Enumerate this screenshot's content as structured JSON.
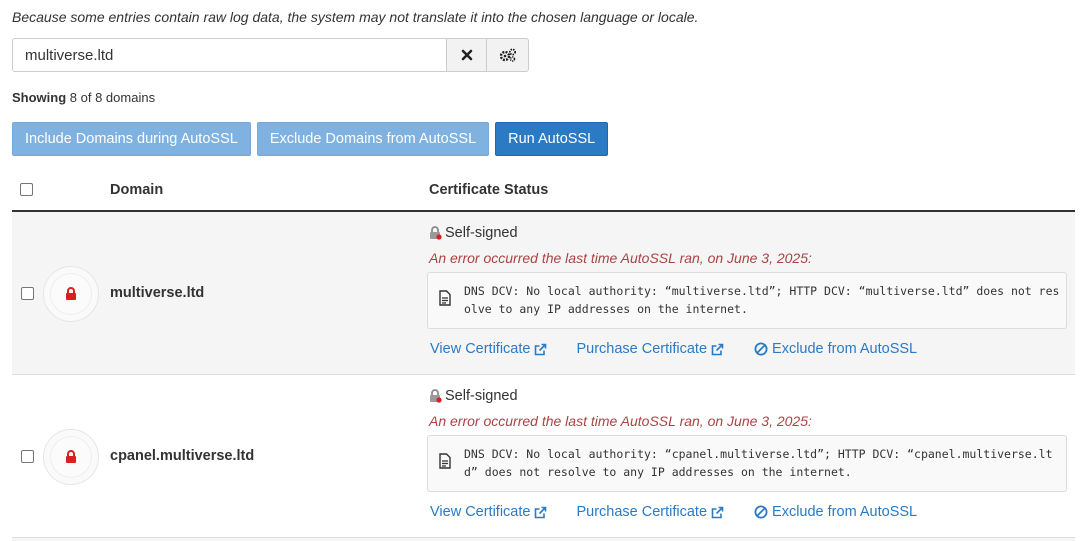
{
  "notice": "Because some entries contain raw log data, the system may not translate it into the chosen language or locale.",
  "search": {
    "value": "multiverse.ltd",
    "clear_icon": "close-icon",
    "settings_icon": "gears-icon"
  },
  "showing": {
    "label": "Showing",
    "text": "8 of 8 domains"
  },
  "actions": {
    "include": "Include Domains during AutoSSL",
    "exclude": "Exclude Domains from AutoSSL",
    "run": "Run AutoSSL"
  },
  "table": {
    "headers": {
      "domain": "Domain",
      "status": "Certificate Status"
    },
    "rows": [
      {
        "domain": "multiverse.ltd",
        "status": "Self-signed",
        "error_heading": "An error occurred the last time AutoSSL ran, on June 3, 2025:",
        "error_message": "DNS DCV: No local authority: “multiverse.ltd”; HTTP DCV: “multiverse.ltd” does not resolve to any IP addresses on the internet.",
        "links": {
          "view": "View Certificate",
          "purchase": "Purchase Certificate",
          "exclude": "Exclude from AutoSSL"
        }
      },
      {
        "domain": "cpanel.multiverse.ltd",
        "status": "Self-signed",
        "error_heading": "An error occurred the last time AutoSSL ran, on June 3, 2025:",
        "error_message": "DNS DCV: No local authority: “cpanel.multiverse.ltd”; HTTP DCV: “cpanel.multiverse.ltd” does not resolve to any IP addresses on the internet.",
        "links": {
          "view": "View Certificate",
          "purchase": "Purchase Certificate",
          "exclude": "Exclude from AutoSSL"
        }
      }
    ]
  },
  "colors": {
    "link": "#2a7ac4",
    "error": "#a94442",
    "lock": "#d9201f",
    "primary": "#2a7ac4",
    "disabled": "#7fb2e0"
  }
}
